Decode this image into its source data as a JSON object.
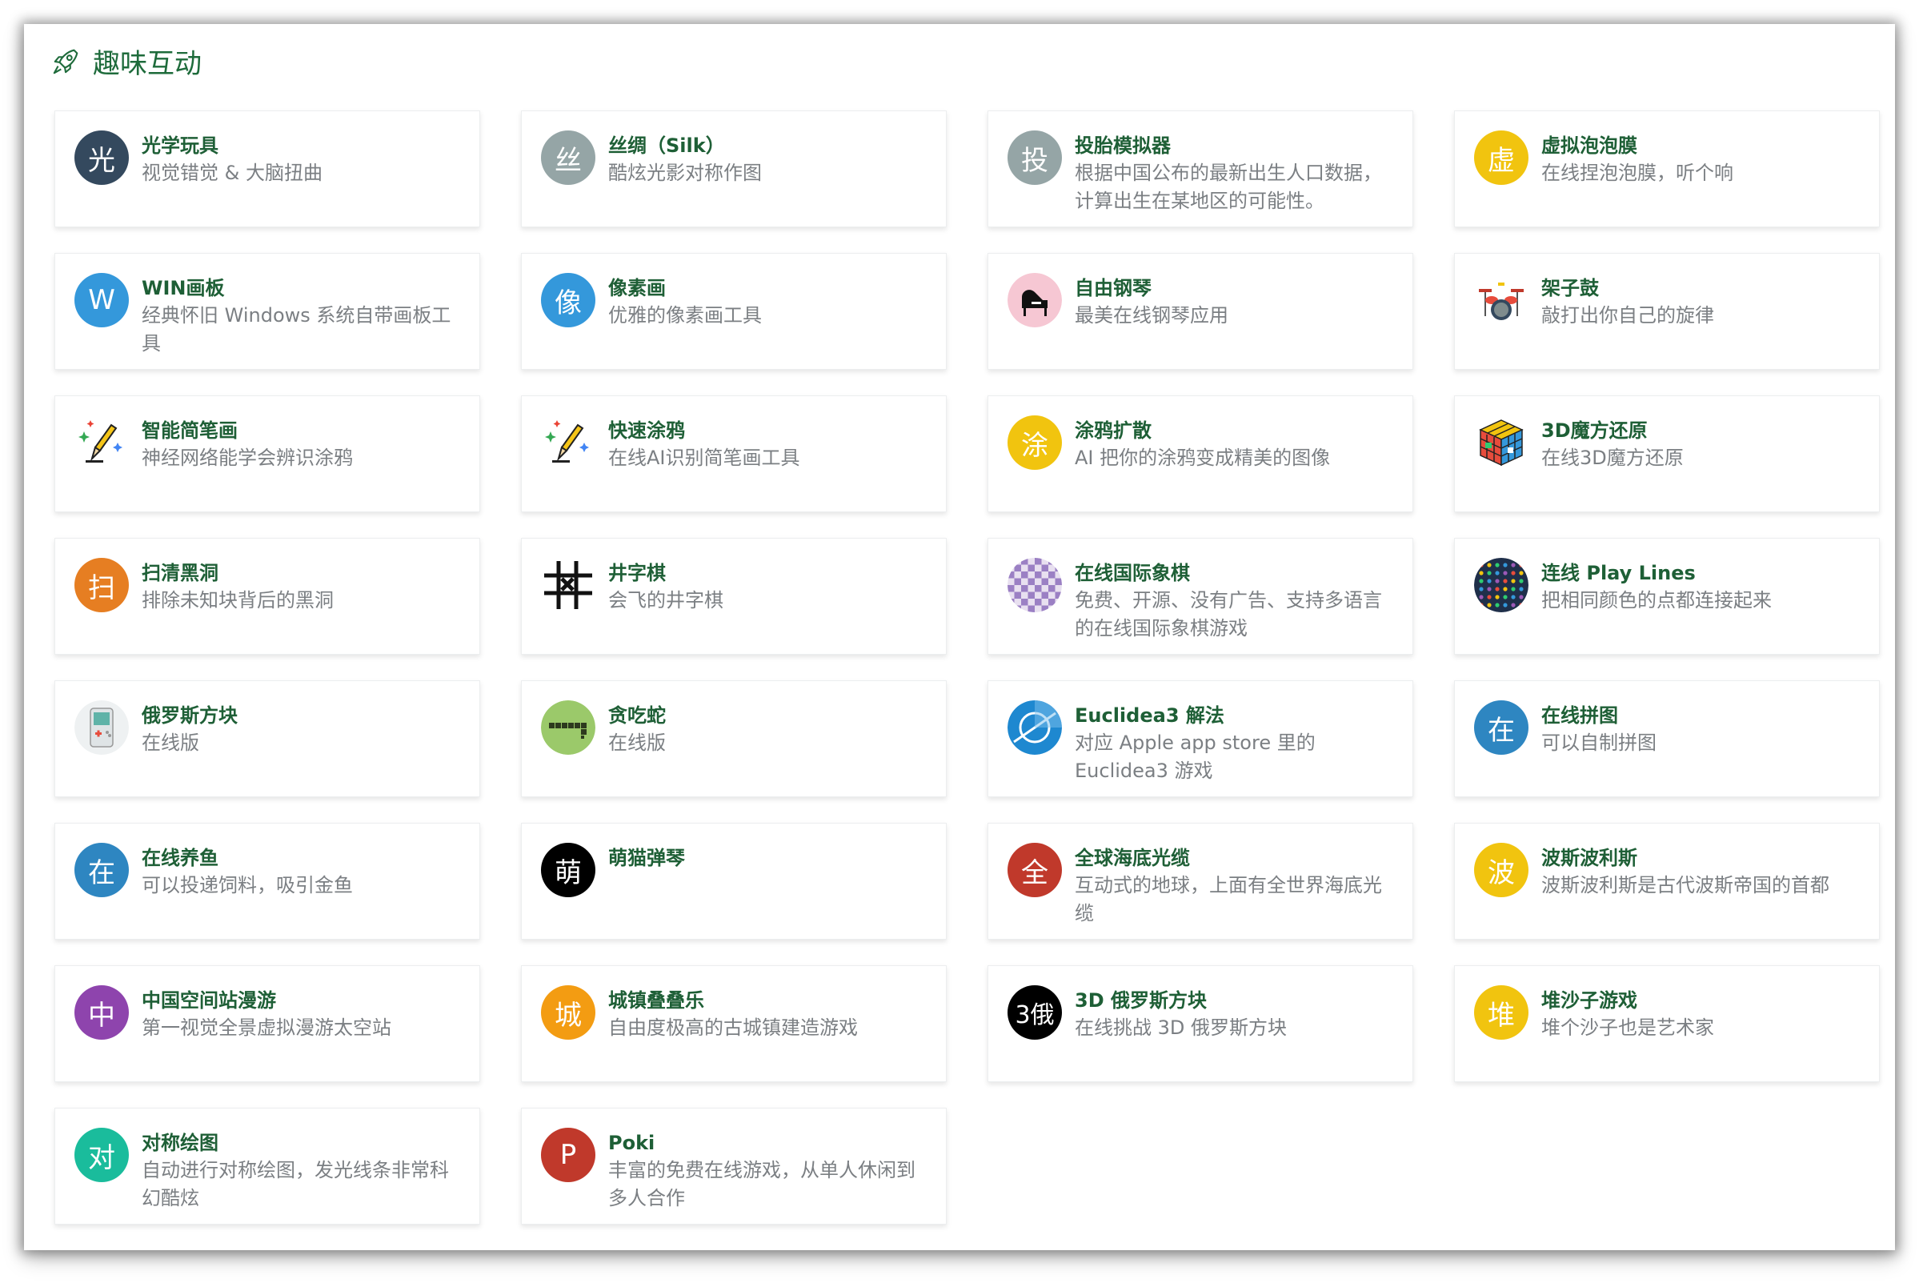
{
  "section": {
    "title": "趣味互动",
    "icon": "rocket-icon"
  },
  "cards": [
    {
      "title": "光学玩具",
      "desc": "视觉错觉 & 大脑扭曲",
      "glyph": "光",
      "color": "#34495e"
    },
    {
      "title": "丝绸（Silk）",
      "desc": "酷炫光影对称作图",
      "glyph": "丝",
      "color": "#95a5a6"
    },
    {
      "title": "投胎模拟器",
      "desc": "根据中国公布的最新出生人口数据，计算出生在某地区的可能性。",
      "glyph": "投",
      "color": "#95a5a6"
    },
    {
      "title": "虚拟泡泡膜",
      "desc": "在线捏泡泡膜，听个响",
      "glyph": "虚",
      "color": "#f1c40f"
    },
    {
      "title": "WIN画板",
      "desc": "经典怀旧 Windows 系统自带画板工具",
      "glyph": "W",
      "color": "#3498db"
    },
    {
      "title": "像素画",
      "desc": "优雅的像素画工具",
      "glyph": "像",
      "color": "#3498db"
    },
    {
      "title": "自由钢琴",
      "desc": "最美在线钢琴应用",
      "glyph": "♪",
      "color": "#f4c6d0",
      "icon": "piano-icon"
    },
    {
      "title": "架子鼓",
      "desc": "敲打出你自己的旋律",
      "glyph": "",
      "color": "transparent",
      "icon": "drum-kit-icon"
    },
    {
      "title": "智能简笔画",
      "desc": "神经网络能学会辨识涂鸦",
      "glyph": "",
      "color": "transparent",
      "icon": "pencil-sparkle-icon"
    },
    {
      "title": "快速涂鸦",
      "desc": "在线AI识别简笔画工具",
      "glyph": "",
      "color": "transparent",
      "icon": "pencil-sparkle-icon"
    },
    {
      "title": "涂鸦扩散",
      "desc": "AI 把你的涂鸦变成精美的图像",
      "glyph": "涂",
      "color": "#f1c40f"
    },
    {
      "title": "3D魔方还原",
      "desc": "在线3D魔方还原",
      "glyph": "",
      "color": "transparent",
      "icon": "rubiks-cube-icon"
    },
    {
      "title": "扫清黑洞",
      "desc": "排除未知块背后的黑洞",
      "glyph": "扫",
      "color": "#e67e22"
    },
    {
      "title": "井字棋",
      "desc": "会飞的井字棋",
      "glyph": "",
      "color": "transparent",
      "icon": "tic-tac-toe-icon"
    },
    {
      "title": "在线国际象棋",
      "desc": "免费、开源、没有广告、支持多语言的在线国际象棋游戏",
      "glyph": "",
      "color": "transparent",
      "icon": "chessboard-icon"
    },
    {
      "title": "连线 Play Lines",
      "desc": "把相同颜色的点都连接起来",
      "glyph": "",
      "color": "#1f2f4a",
      "icon": "dots-grid-icon"
    },
    {
      "title": "俄罗斯方块",
      "desc": "在线版",
      "glyph": "",
      "color": "#eef1f2",
      "icon": "gameboy-icon"
    },
    {
      "title": "贪吃蛇",
      "desc": "在线版",
      "glyph": "",
      "color": "#9bc96a",
      "icon": "snake-icon"
    },
    {
      "title": "Euclidea3 解法",
      "desc": "对应 Apple app store 里的 Euclidea3 游戏",
      "glyph": "",
      "color": "#1e88d0",
      "icon": "euclidea-icon"
    },
    {
      "title": "在线拼图",
      "desc": "可以自制拼图",
      "glyph": "在",
      "color": "#2e86c1"
    },
    {
      "title": "在线养鱼",
      "desc": "可以投递饲料，吸引金鱼",
      "glyph": "在",
      "color": "#2e86c1"
    },
    {
      "title": "萌猫弹琴",
      "desc": "",
      "glyph": "萌",
      "color": "#000000"
    },
    {
      "title": "全球海底光缆",
      "desc": "互动式的地球，上面有全世界海底光缆",
      "glyph": "全",
      "color": "#c0392b"
    },
    {
      "title": "波斯波利斯",
      "desc": "波斯波利斯是古代波斯帝国的首都",
      "glyph": "波",
      "color": "#f1c40f"
    },
    {
      "title": "中国空间站漫游",
      "desc": "第一视觉全景虚拟漫游太空站",
      "glyph": "中",
      "color": "#8e44ad"
    },
    {
      "title": "城镇叠叠乐",
      "desc": "自由度极高的古城镇建造游戏",
      "glyph": "城",
      "color": "#f39c12"
    },
    {
      "title": "3D 俄罗斯方块",
      "desc": "在线挑战 3D 俄罗斯方块",
      "glyph": "3俄",
      "color": "#000000"
    },
    {
      "title": "堆沙子游戏",
      "desc": "堆个沙子也是艺术家",
      "glyph": "堆",
      "color": "#f1c40f"
    },
    {
      "title": "对称绘图",
      "desc": "自动进行对称绘图，发光线条非常科幻酷炫",
      "glyph": "对",
      "color": "#1abc9c"
    },
    {
      "title": "Poki",
      "desc": "丰富的免费在线游戏，从单人休闲到多人合作",
      "glyph": "P",
      "color": "#c0392b"
    }
  ]
}
